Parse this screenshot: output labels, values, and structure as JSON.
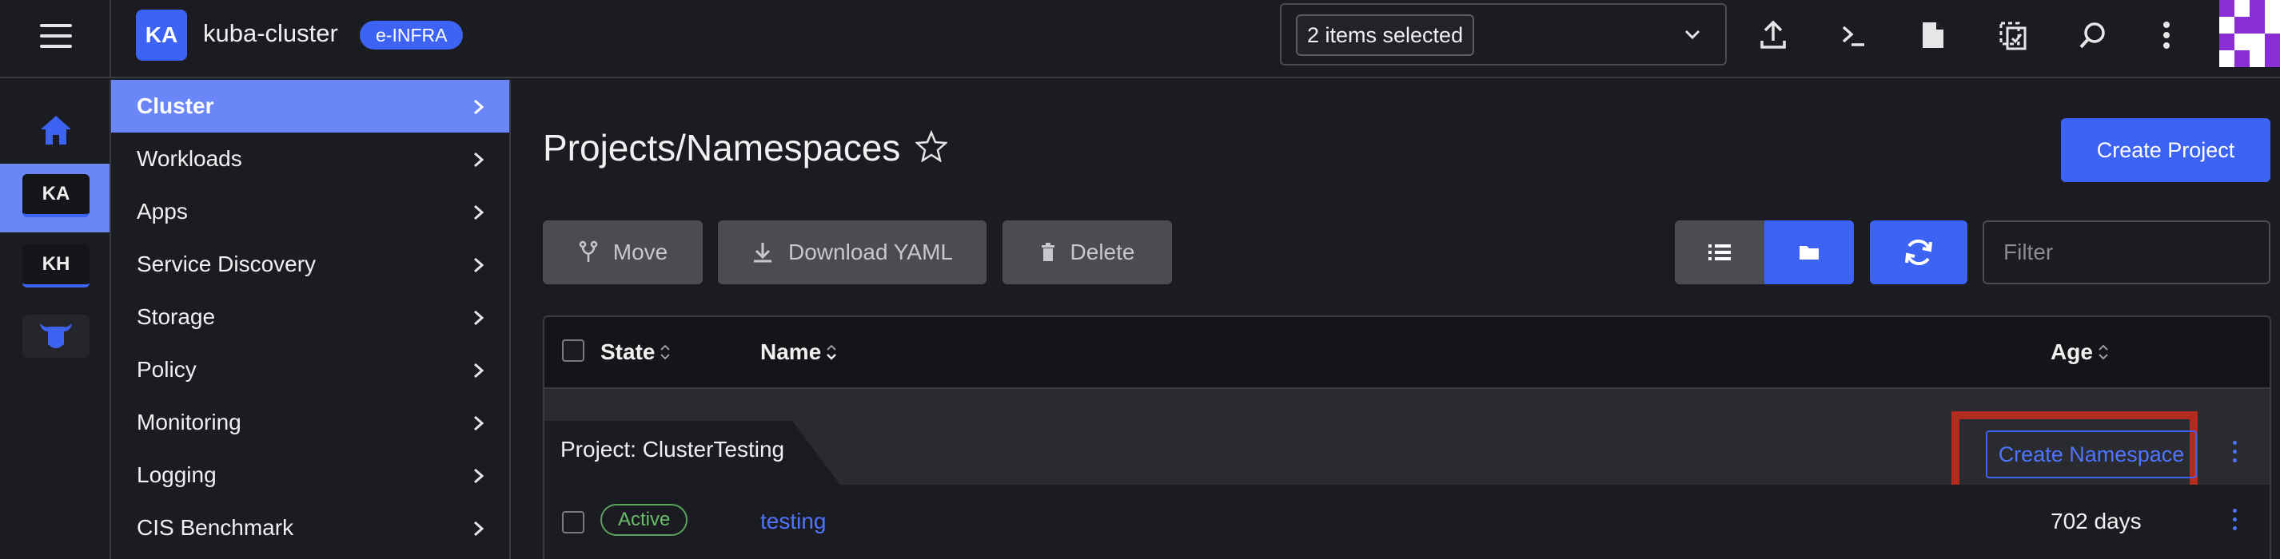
{
  "header": {
    "cluster_initials": "KA",
    "cluster_name": "kuba-cluster",
    "env_badge": "e-INFRA",
    "namespace_selector": "2 items selected"
  },
  "rail": {
    "items": [
      {
        "label": "KA"
      },
      {
        "label": "KH"
      }
    ]
  },
  "sidebar": {
    "items": [
      {
        "label": "Cluster",
        "active": true
      },
      {
        "label": "Workloads"
      },
      {
        "label": "Apps"
      },
      {
        "label": "Service Discovery"
      },
      {
        "label": "Storage"
      },
      {
        "label": "Policy"
      },
      {
        "label": "Monitoring"
      },
      {
        "label": "Logging"
      },
      {
        "label": "CIS Benchmark"
      }
    ]
  },
  "main": {
    "title": "Projects/Namespaces",
    "create_project_label": "Create Project",
    "toolbar": {
      "move_label": "Move",
      "download_label": "Download YAML",
      "delete_label": "Delete",
      "filter_placeholder": "Filter"
    },
    "table": {
      "columns": [
        "State",
        "Name",
        "Age"
      ],
      "group": {
        "label": "Project: ClusterTesting",
        "create_namespace_label": "Create Namespace"
      },
      "rows": [
        {
          "state": "Active",
          "name": "testing",
          "age": "702 days"
        }
      ]
    }
  },
  "colors": {
    "accent": "#3d63f5",
    "active_nav": "#6b87f7",
    "background": "#1b1c21",
    "highlight": "#b32a1f",
    "status_active": "#5aa35a"
  }
}
